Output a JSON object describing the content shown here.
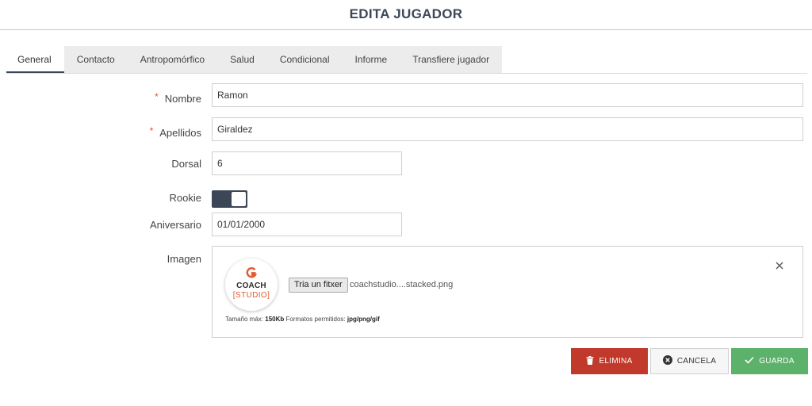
{
  "page": {
    "title": "EDITA JUGADOR"
  },
  "tabs": [
    {
      "label": "General",
      "active": true
    },
    {
      "label": "Contacto"
    },
    {
      "label": "Antropomórfico"
    },
    {
      "label": "Salud"
    },
    {
      "label": "Condicional"
    },
    {
      "label": "Informe"
    },
    {
      "label": "Transfiere jugador"
    }
  ],
  "form": {
    "required_marker": "*",
    "nombre": {
      "label": "Nombre",
      "value": "Ramon",
      "required": true
    },
    "apellidos": {
      "label": "Apellidos",
      "value": "Giraldez",
      "required": true
    },
    "dorsal": {
      "label": "Dorsal",
      "value": "6"
    },
    "rookie": {
      "label": "Rookie",
      "checked": true
    },
    "aniversario": {
      "label": "Aniversario",
      "value": "01/01/2000"
    },
    "imagen": {
      "label": "Imagen",
      "logo_line1": "COACH",
      "logo_line2": "[STUDIO]",
      "file_button": "Tria un fitxer",
      "file_name": "coachstudio....stacked.png",
      "size_prefix": "Tamaño máx:",
      "size_value": "150Kb",
      "formats_prefix": "Formatos permitidos:",
      "formats_value": "jpg/png/gif"
    }
  },
  "actions": {
    "delete": "ELIMINA",
    "cancel": "CANCELA",
    "save": "GUARDA"
  },
  "colors": {
    "accent": "#3b4656",
    "danger": "#c0392b",
    "success": "#5cb16b",
    "required": "#d9533b",
    "brand_orange": "#e05a32"
  },
  "icons": {
    "delete": "trash-icon",
    "cancel": "times-circle-icon",
    "save": "check-icon",
    "remove_image": "close-icon"
  }
}
